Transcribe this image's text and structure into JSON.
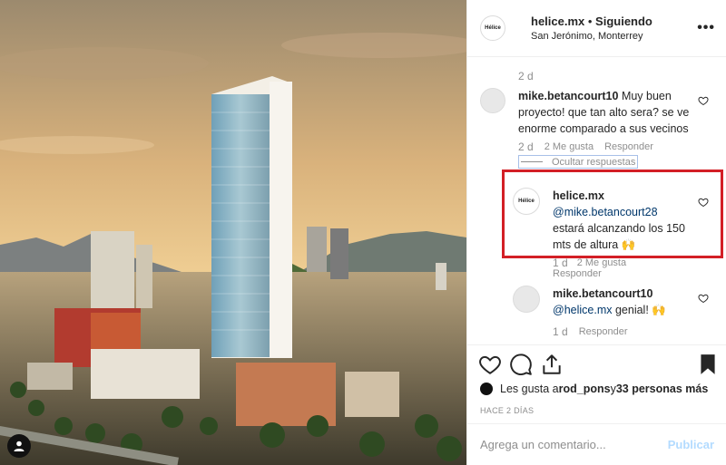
{
  "post": {
    "username": "helice.mx",
    "separator": " • ",
    "follow_status": "Siguiendo",
    "location": "San Jerónimo, Monterrey",
    "avatar_text": "Hélice",
    "more_icon": "more-horizontal-icon"
  },
  "comments": {
    "top_timestamp": "2 d",
    "first": {
      "username": "mike.betancourt10",
      "text": " Muy buen proyecto! que tan alto sera? se ve enorme comparado a sus vecinos",
      "timestamp": "2 d",
      "likes": "2 Me gusta",
      "reply_label": "Responder"
    },
    "toggle_replies": "Ocultar respuestas",
    "reply1": {
      "username": "helice.mx",
      "mention": "@mike.betancourt28",
      "text": " estará alcanzando los 150 mts de altura 🙌",
      "timestamp": "1 d",
      "likes": "2 Me gusta",
      "reply_label": "Responder"
    },
    "reply2": {
      "username": "mike.betancourt10",
      "mention": "@helice.mx",
      "text": " genial! 🙌",
      "timestamp": "1 d",
      "reply_label": "Responder"
    }
  },
  "engagement": {
    "likes_prefix": "Les gusta a ",
    "liker": "rod_pons",
    "likes_mid": " y ",
    "likes_count": "33 personas más",
    "date": "HACE 2 DÍAS"
  },
  "composer": {
    "placeholder": "Agrega un comentario...",
    "publish_label": "Publicar"
  },
  "colors": {
    "highlight": "#d31f26",
    "mention": "#00376b",
    "muted": "#8e8e8e",
    "publish_disabled": "#b3dbff"
  }
}
